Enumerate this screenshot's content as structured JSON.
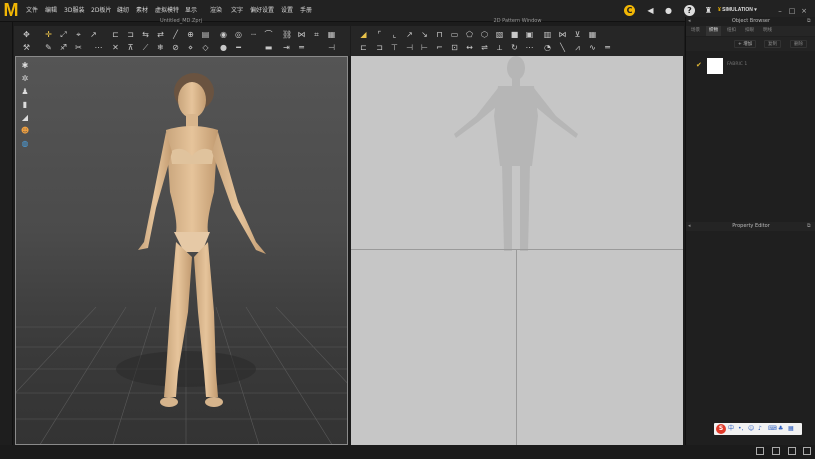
{
  "app": {
    "logo": "M",
    "menu": [
      "文件",
      "编辑",
      "3D服装",
      "2D板片",
      "缝纫",
      "素材",
      "虚拟模特",
      "显示",
      "渲染",
      "文字",
      "显示",
      "偏好设置",
      "设置",
      "手册"
    ],
    "mode_label": "SIMULATION"
  },
  "windows": {
    "view3d_title": "Untitled_MD.Zprj",
    "view2d_title": "2D Pattern Window"
  },
  "object_browser": {
    "title": "Object Browser",
    "tabs": [
      "场景",
      "织物",
      "纽扣",
      "扣眼",
      "明线"
    ],
    "add_label": "+ 增加",
    "btn2": "复制",
    "btn3": "删除",
    "item_label": "FABRIC 1"
  },
  "property_editor": {
    "title": "Property Editor"
  },
  "icons": {
    "accent": "#f2b705"
  }
}
